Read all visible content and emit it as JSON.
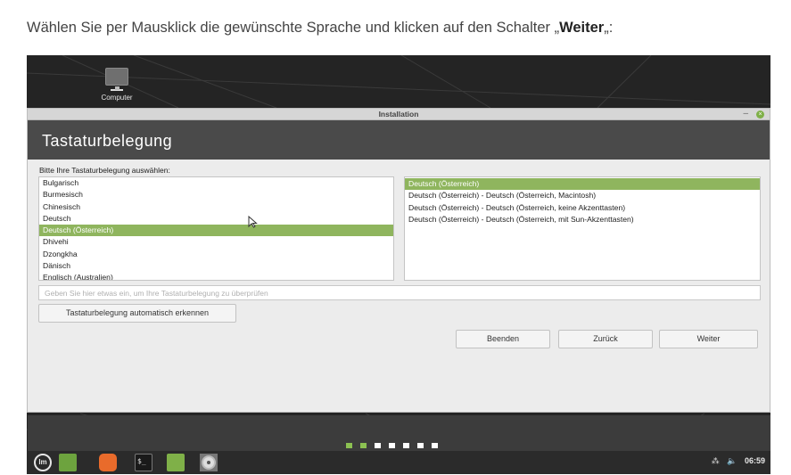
{
  "instruction": {
    "text_before": "Wählen Sie per Mausklick die gewünschte Sprache und klicken auf den Schalter „",
    "bold": "Weiter",
    "text_after": "„:"
  },
  "desktop": {
    "icon_label": "Computer"
  },
  "window": {
    "title": "Installation",
    "minimize_glyph": "–",
    "close_glyph": "×",
    "header": "Tastaturbelegung",
    "prompt": "Bitte Ihre Tastaturbelegung auswählen:",
    "layouts": [
      "Bulgarisch",
      "Burmesisch",
      "Chinesisch",
      "Deutsch",
      "Deutsch (Österreich)",
      "Dhivehi",
      "Dzongkha",
      "Dänisch",
      "Englisch (Australien)"
    ],
    "layouts_selected_index": 4,
    "variants": [
      "Deutsch (Österreich)",
      "Deutsch (Österreich) - Deutsch (Österreich, Macintosh)",
      "Deutsch (Österreich) - Deutsch (Österreich, keine Akzenttasten)",
      "Deutsch (Österreich) - Deutsch (Österreich, mit Sun-Akzenttasten)"
    ],
    "variants_selected_index": 0,
    "test_placeholder": "Geben Sie hier etwas ein, um Ihre Tastaturbelegung zu überprüfen",
    "detect_button": "Tastaturbelegung automatisch erkennen",
    "quit_button": "Beenden",
    "back_button": "Zurück",
    "next_button": "Weiter"
  },
  "progress": {
    "total_steps": 7,
    "completed_steps": 2
  },
  "taskbar": {
    "menu_icon": "linux-mint-menu-icon",
    "terminal_glyph": "$_",
    "clock": "06:59",
    "network_glyph": "⁂",
    "volume_glyph": "🔈"
  },
  "colors": {
    "selection": "#8fb55e",
    "progress_done": "#8cc152",
    "header_band": "#4a4a4a"
  }
}
